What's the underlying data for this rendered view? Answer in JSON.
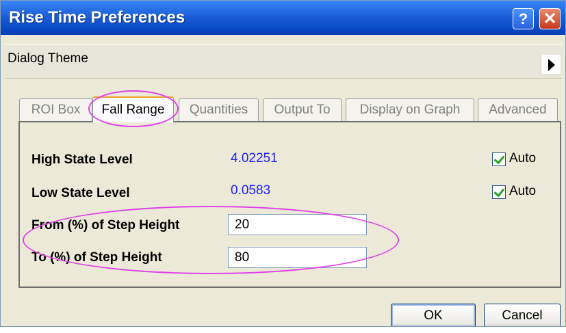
{
  "window": {
    "title": "Rise Time Preferences"
  },
  "titlebar": {
    "help_label": "?",
    "close_label": "✕"
  },
  "theme": {
    "label": "Dialog Theme"
  },
  "tabs": [
    {
      "label": "ROI Box",
      "active": false
    },
    {
      "label": "Fall Range",
      "active": true
    },
    {
      "label": "Quantities",
      "active": false
    },
    {
      "label": "Output To",
      "active": false
    },
    {
      "label": "Display on Graph",
      "active": false
    },
    {
      "label": "Advanced",
      "active": false
    }
  ],
  "fields": {
    "high_state": {
      "label": "High State Level",
      "value": "4.02251",
      "auto_label": "Auto",
      "auto_checked": true
    },
    "low_state": {
      "label": "Low State Level",
      "value": "0.0583",
      "auto_label": "Auto",
      "auto_checked": true
    },
    "from_pct": {
      "label": "From (%) of Step Height",
      "value": "20"
    },
    "to_pct": {
      "label": "To (%) of Step Height",
      "value": "80"
    }
  },
  "buttons": {
    "ok": "OK",
    "cancel": "Cancel"
  },
  "colors": {
    "title_bar": "#0a4ac6",
    "value_text": "#1f1fff",
    "annotation": "#e040e8",
    "checkbox_mark": "#21a121"
  },
  "icons": {
    "help": "help-icon",
    "close": "close-icon",
    "theme_menu": "triangle-right-icon",
    "check": "checkmark-icon"
  }
}
